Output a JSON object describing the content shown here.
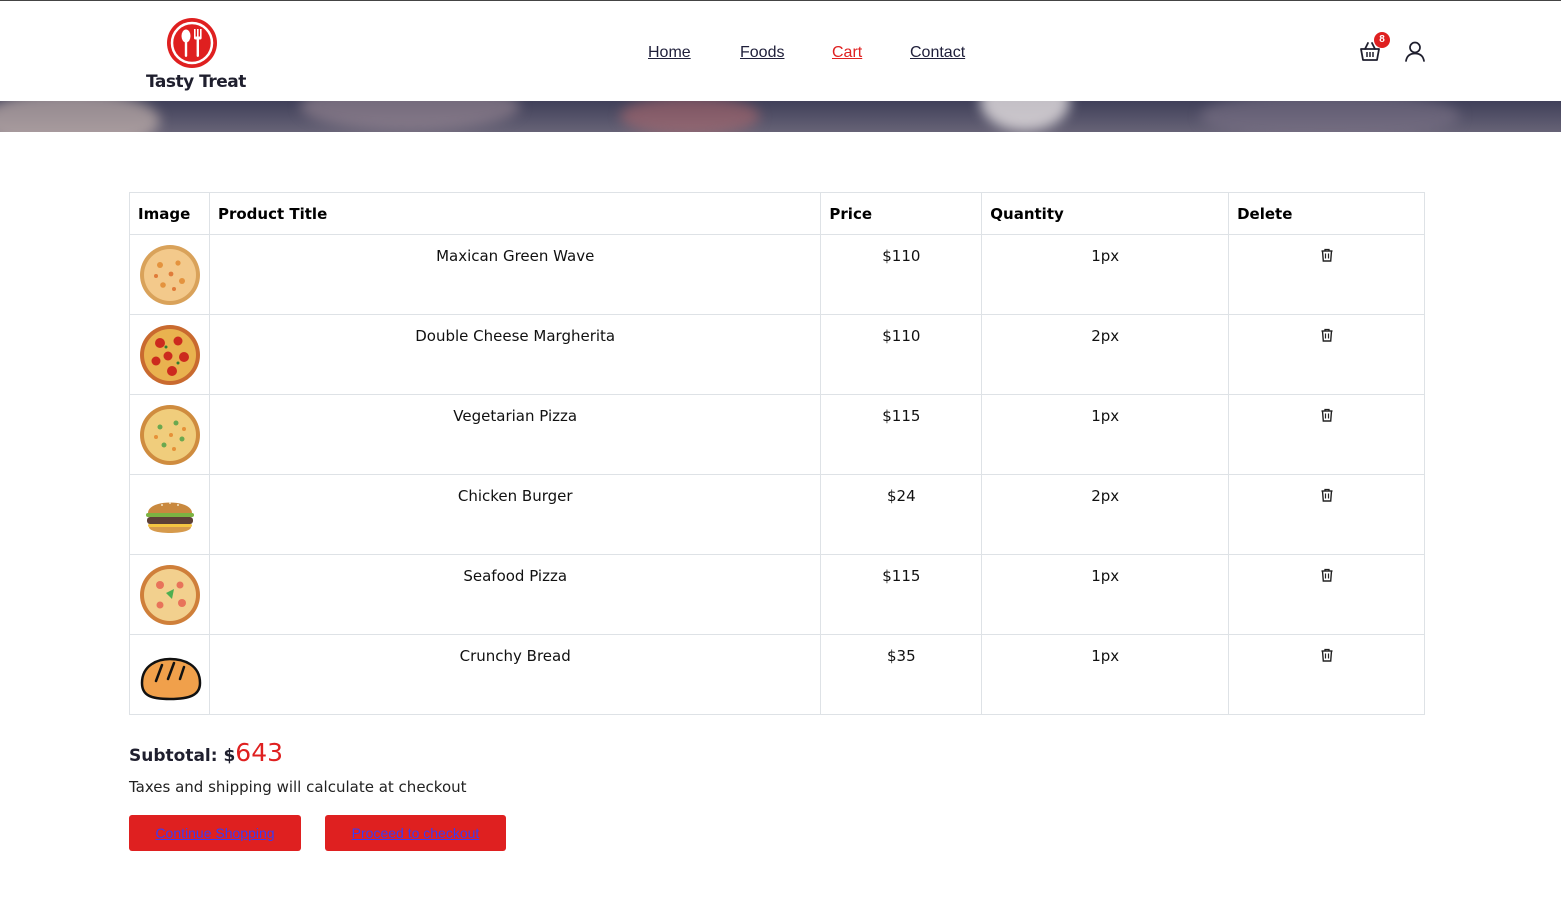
{
  "brand": {
    "name": "Tasty Treat"
  },
  "nav": {
    "items": [
      {
        "label": "Home"
      },
      {
        "label": "Foods"
      },
      {
        "label": "Cart"
      },
      {
        "label": "Contact"
      }
    ],
    "active": "Cart"
  },
  "header": {
    "cart_count": "8",
    "cart_icon": "shopping-basket-icon",
    "user_icon": "user-icon"
  },
  "table": {
    "headers": {
      "image": "Image",
      "title": "Product Title",
      "price": "Price",
      "quantity": "Quantity",
      "delete": "Delete"
    },
    "rows": [
      {
        "title": "Maxican Green Wave",
        "price": "$110",
        "quantity": "1px",
        "image": "pizza-green-wave"
      },
      {
        "title": "Double Cheese Margherita",
        "price": "$110",
        "quantity": "2px",
        "image": "pizza-margherita"
      },
      {
        "title": "Vegetarian Pizza",
        "price": "$115",
        "quantity": "1px",
        "image": "pizza-vegetarian"
      },
      {
        "title": "Chicken Burger",
        "price": "$24",
        "quantity": "2px",
        "image": "chicken-burger"
      },
      {
        "title": "Seafood Pizza",
        "price": "$115",
        "quantity": "1px",
        "image": "pizza-seafood"
      },
      {
        "title": "Crunchy Bread",
        "price": "$35",
        "quantity": "1px",
        "image": "crunchy-bread"
      }
    ],
    "delete_icon": "trash-icon"
  },
  "summary": {
    "subtotal_label": "Subtotal: $",
    "subtotal_value": "643",
    "note": "Taxes and shipping will calculate at checkout"
  },
  "actions": {
    "continue_label": "Continue Shopping",
    "checkout_label": "Proceed to checkout"
  },
  "colors": {
    "accent": "#df2020",
    "text": "#1f1f2e",
    "link": "#3b3bf0"
  }
}
